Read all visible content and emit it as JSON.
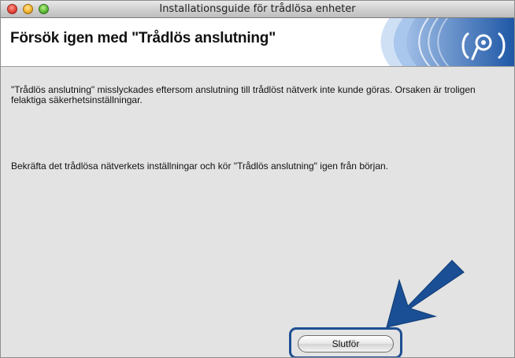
{
  "window": {
    "title": "Installationsguide för trådlösa enheter"
  },
  "header": {
    "heading": "Försök igen med \"Trådlös anslutning\""
  },
  "content": {
    "paragraph_1": "\"Trådlös anslutning\" misslyckades eftersom anslutning till trådlöst nätverk inte kunde göras. Orsaken är troligen felaktiga säkerhetsinställningar.",
    "paragraph_2": "Bekräfta det trådlösa nätverkets inställningar och kör \"Trådlös anslutning\" igen från början."
  },
  "buttons": {
    "finish_label": "Slutför"
  },
  "colors": {
    "accent_blue": "#1d4f93",
    "header_swoosh": "#2a5fa8"
  },
  "icons": {
    "logo": "wireless-signal-icon",
    "pointer": "arrow-icon"
  }
}
